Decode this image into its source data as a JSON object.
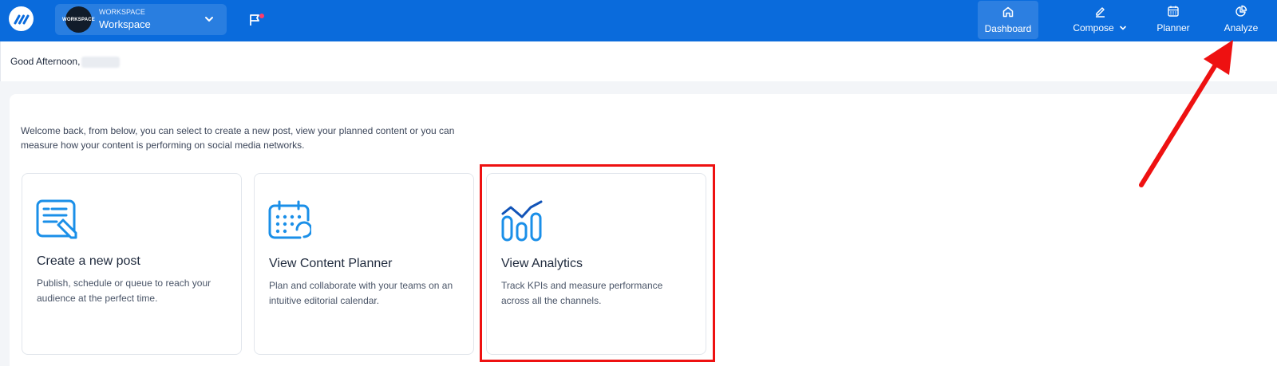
{
  "app": {
    "workspace_small_label": "WORKSPACE",
    "workspace_name": "Workspace",
    "workspace_avatar_text": "WORKSPACE"
  },
  "nav": {
    "items": [
      {
        "label": "Dashboard",
        "icon": "home-icon"
      },
      {
        "label": "Compose",
        "icon": "edit-icon"
      },
      {
        "label": "Planner",
        "icon": "calendar-icon"
      },
      {
        "label": "Analyze",
        "icon": "pie-chart-icon"
      }
    ]
  },
  "greeting": "Good Afternoon,",
  "welcome_text": "Welcome back, from below, you can select to create a new post, view your planned content or you can measure how your content is performing on social media networks.",
  "cards": [
    {
      "title": "Create a new post",
      "description": "Publish, schedule or queue to reach your audience at the perfect time.",
      "icon": "create-post-icon"
    },
    {
      "title": "View Content Planner",
      "description": "Plan and collaborate with your teams on an intuitive editorial calendar.",
      "icon": "content-planner-icon"
    },
    {
      "title": "View Analytics",
      "description": "Track KPIs and measure performance across all the channels.",
      "icon": "analytics-icon"
    }
  ],
  "colors": {
    "topbar": "#0a6bdc",
    "highlight": "#ee1111",
    "icon_blue": "#1a8fe8"
  }
}
